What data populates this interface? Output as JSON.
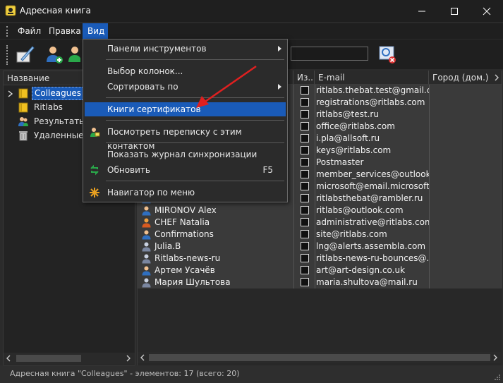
{
  "window": {
    "title": "Адресная книга"
  },
  "menubar": {
    "items": [
      "Файл",
      "Правка",
      "Вид"
    ],
    "active": "Вид"
  },
  "view_menu": {
    "items": [
      {
        "label": "Панели инструментов",
        "submenu": true
      },
      {
        "label": "Выбор колонок...",
        "submenu": false
      },
      {
        "label": "Сортировать по",
        "submenu": true
      },
      {
        "label": "Книги сертификатов",
        "submenu": false,
        "highlighted": true
      },
      {
        "label": "Посмотреть переписку с этим контактом",
        "submenu": false
      },
      {
        "label": "Показать журнал синхронизации",
        "submenu": false
      },
      {
        "label": "Обновить",
        "shortcut": "F5",
        "submenu": false
      },
      {
        "label": "Навигатор по меню",
        "submenu": false
      }
    ]
  },
  "tree": {
    "header": "Название",
    "items": [
      {
        "label": "Colleagues",
        "selected": true
      },
      {
        "label": "Ritlabs"
      },
      {
        "label": "Результаты п"
      },
      {
        "label": "Удаленные э"
      }
    ]
  },
  "contacts": {
    "columns": [
      "Из...",
      "E-mail",
      "Город (дом.)"
    ],
    "rows": [
      {
        "name": "",
        "email": "ritlabs.thebat.test@gmail.co..."
      },
      {
        "name": "",
        "email": "registrations@ritlabs.com"
      },
      {
        "name": "",
        "email": "ritlabs@test.ru"
      },
      {
        "name": "",
        "email": "office@ritlabs.com"
      },
      {
        "name": "",
        "email": "i.pla@allsoft.ru"
      },
      {
        "name": "",
        "email": "keys@ritlabs.com"
      },
      {
        "name": "",
        "email": "Postmaster"
      },
      {
        "name": "",
        "email": "member_services@outlook...."
      },
      {
        "name": "",
        "email": "microsoft@email.microsoft...."
      },
      {
        "name": "",
        "email": "ritlabsthebat@rambler.ru"
      },
      {
        "name": "MIRONOV Alex",
        "email": "ritlabs@outlook.com"
      },
      {
        "name": "CHEF Natalia",
        "email": "administrative@ritlabs.com"
      },
      {
        "name": "Confirmations",
        "email": "site@ritlabs.com"
      },
      {
        "name": "Julia.B",
        "email": "lng@alerts.assembla.com"
      },
      {
        "name": "Ritlabs-news-ru",
        "email": "ritlabs-news-ru-bounces@..."
      },
      {
        "name": "Артем Усачёв",
        "email": "art@art-design.co.uk"
      },
      {
        "name": "Мария Шультова",
        "email": "maria.shultova@mail.ru"
      }
    ]
  },
  "status": {
    "text": "Адресная книга \"Colleagues\" - элементов: 17 (всего: 20)"
  },
  "colors": {
    "accent": "#1a5bb8",
    "arrow": "#e02020",
    "background": "#2b2b2b"
  }
}
